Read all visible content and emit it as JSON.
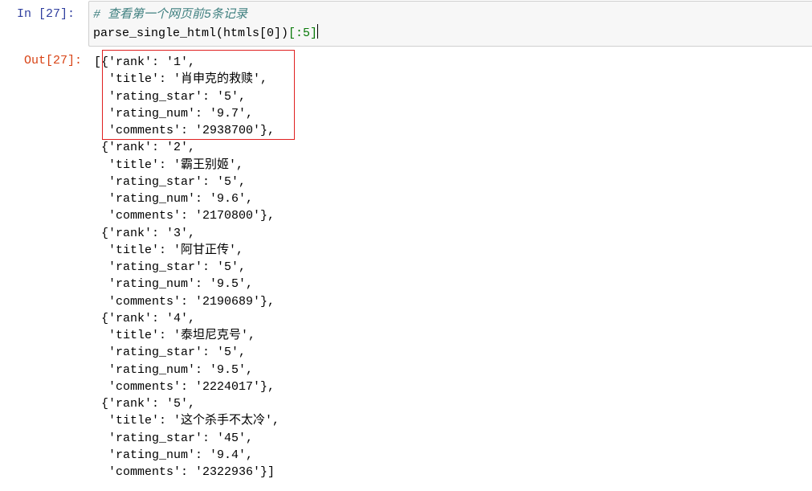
{
  "input_cell": {
    "prompt": "In  [27]:",
    "comment": "# 查看第一个网页前5条记录",
    "code_main": "parse_single_html(htmls[0])",
    "code_slice": "[:5]"
  },
  "output_cell": {
    "prompt": "Out[27]:",
    "records": [
      {
        "rank": "1",
        "title": "肖申克的救赎",
        "rating_star": "5",
        "rating_num": "9.7",
        "comments": "2938700"
      },
      {
        "rank": "2",
        "title": "霸王别姬",
        "rating_star": "5",
        "rating_num": "9.6",
        "comments": "2170800"
      },
      {
        "rank": "3",
        "title": "阿甘正传",
        "rating_star": "5",
        "rating_num": "9.5",
        "comments": "2190689"
      },
      {
        "rank": "4",
        "title": "泰坦尼克号",
        "rating_star": "5",
        "rating_num": "9.5",
        "comments": "2224017"
      },
      {
        "rank": "5",
        "title": "这个杀手不太冷",
        "rating_star": "45",
        "rating_num": "9.4",
        "comments": "2322936"
      }
    ]
  },
  "colors": {
    "highlight_box": "#e02020",
    "in_prompt": "#303F9F",
    "out_prompt": "#D84315",
    "comment": "#408080"
  }
}
